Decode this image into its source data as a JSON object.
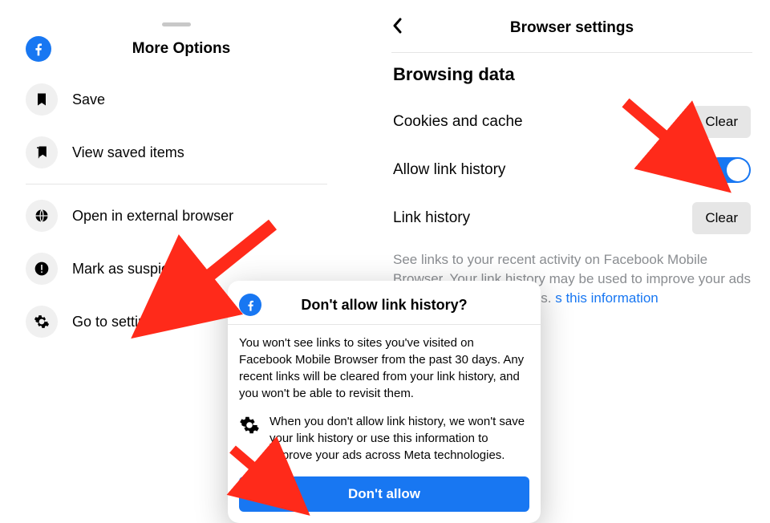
{
  "moreOptions": {
    "title": "More Options",
    "items": [
      {
        "label": "Save"
      },
      {
        "label": "View saved items"
      },
      {
        "label": "Open in external browser"
      },
      {
        "label": "Mark as suspicious"
      },
      {
        "label": "Go to settings"
      }
    ]
  },
  "browserSettings": {
    "title": "Browser settings",
    "section": "Browsing data",
    "cookies": {
      "label": "Cookies and cache",
      "button": "Clear"
    },
    "allowLinkHistory": {
      "label": "Allow link history",
      "on": true
    },
    "linkHistory": {
      "label": "Link history",
      "button": "Clear"
    },
    "description": "See links to your recent activity on Facebook Mobile Browser. Your link history may be used to improve your ads across Meta technologies.",
    "linkText": "s this information"
  },
  "modal": {
    "title": "Don't allow link history?",
    "body": "You won't see links to sites you've visited on Facebook Mobile Browser from the past 30 days. Any recent links will be cleared from your link history, and you won't be able to revisit them.",
    "info": "When you don't allow link history, we won't save your link history or use this information to improve your ads across Meta technologies.",
    "button": "Don't allow"
  }
}
